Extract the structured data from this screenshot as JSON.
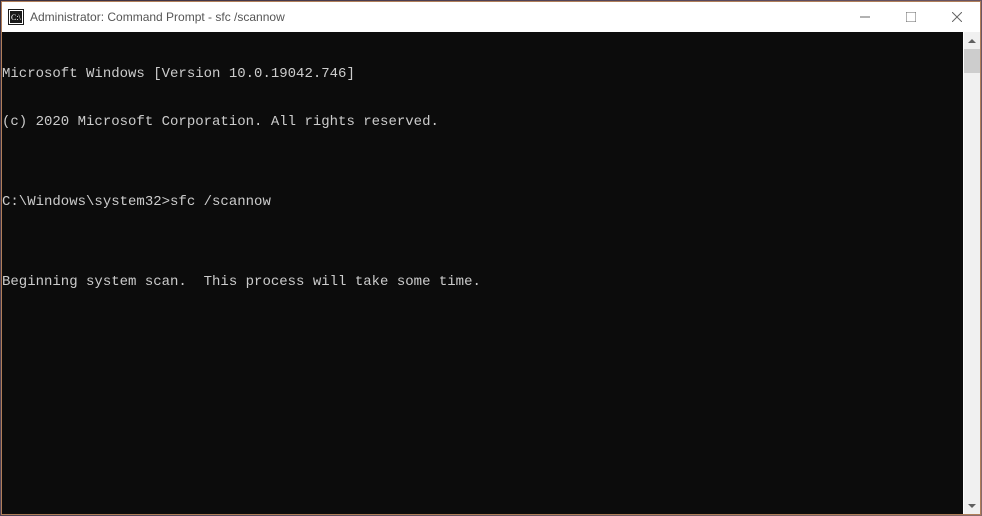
{
  "window": {
    "title": "Administrator: Command Prompt - sfc  /scannow"
  },
  "terminal": {
    "lines": [
      "Microsoft Windows [Version 10.0.19042.746]",
      "(c) 2020 Microsoft Corporation. All rights reserved.",
      "",
      "C:\\Windows\\system32>sfc /scannow",
      "",
      "Beginning system scan.  This process will take some time.",
      ""
    ]
  }
}
